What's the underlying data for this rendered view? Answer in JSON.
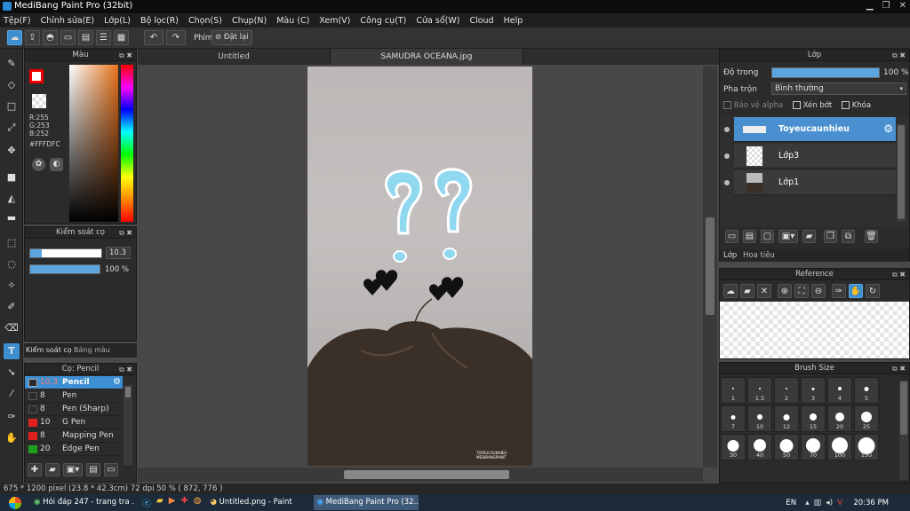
{
  "window": {
    "title": "MediBang Paint Pro (32bit)"
  },
  "menu": [
    "Tệp(F)",
    "Chỉnh sửa(E)",
    "Lớp(L)",
    "Bộ lọc(R)",
    "Chọn(S)",
    "Chụp(N)",
    "Màu (C)",
    "Xem(V)",
    "Công cụ(T)",
    "Cửa sổ(W)",
    "Cloud",
    "Help"
  ],
  "toolbar": {
    "phim_label": "Phím",
    "reset_label": "Đặt lại"
  },
  "color_panel": {
    "title": "Màu",
    "r": "R:255",
    "g": "G:253",
    "b": "B:252",
    "hex": "#FFFDFC"
  },
  "brush_control": {
    "title": "Kiểm soát cọ",
    "size": "10.3",
    "opacity": "100 %",
    "opacity_fill": 1.0,
    "size_fill": 0.16
  },
  "sub_tabs": {
    "brush_ctrl": "Kiểm soát cọ",
    "color_table": "Bảng màu"
  },
  "brush_panel": {
    "title": "Cọ: Pencil",
    "items": [
      {
        "size": "10.3",
        "name": "Pencil",
        "color": "#2b2b2b",
        "selected": true
      },
      {
        "size": "8",
        "name": "Pen",
        "color": "#2b2b2b"
      },
      {
        "size": "8",
        "name": "Pen (Sharp)",
        "color": "#2b2b2b"
      },
      {
        "size": "10",
        "name": "G Pen",
        "color": "#e02020"
      },
      {
        "size": "8",
        "name": "Mapping Pen",
        "color": "#e02020"
      },
      {
        "size": "20",
        "name": "Edge Pen",
        "color": "#1ea01e"
      }
    ]
  },
  "tabs": [
    "Untitled",
    "SAMUDRA OCEANA.jpg"
  ],
  "artwork": {
    "watermark_line1": "TOYEUCAUNHIEU",
    "watermark_line2": "MEDIBANGPAINT"
  },
  "layer_panel": {
    "title": "Lớp",
    "opacity_label": "Độ trong",
    "opacity_value": "100 %",
    "opacity_fill": 1.0,
    "blend_label": "Pha trộn",
    "blend_value": "Bình thường",
    "protect_alpha": "Bảo vệ alpha",
    "clipping": "Xén bớt",
    "lock": "Khóa",
    "layers": [
      {
        "name": "Toyeucaunhieu",
        "selected": true
      },
      {
        "name": "Lớp3"
      },
      {
        "name": "Lớp1"
      }
    ],
    "tab_layer": "Lớp",
    "tab_nav": "Hoa tiêu"
  },
  "reference_panel": {
    "title": "Reference"
  },
  "brush_size_panel": {
    "title": "Brush Size",
    "sizes": [
      "1",
      "1.5",
      "2",
      "3",
      "4",
      "5",
      "7",
      "10",
      "12",
      "15",
      "20",
      "25",
      "30",
      "40",
      "50",
      "70",
      "100",
      "150"
    ]
  },
  "status": {
    "text": "675 * 1200 pixel   (23.8 * 42.3cm)   72 dpi   50 %   ( 872, 776 )"
  },
  "taskbar": {
    "items": [
      "Hỏi đáp 247 - trang tra ...",
      "Untitled.png - Paint",
      "MediBang Paint Pro (32..."
    ],
    "lang": "EN",
    "time": "20:36 PM"
  }
}
